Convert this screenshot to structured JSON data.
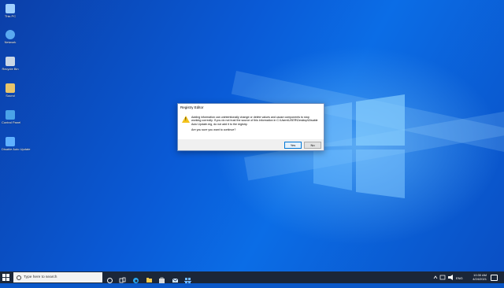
{
  "desktop": {
    "icons": [
      {
        "label": "This PC",
        "icon": "this-pc-icon",
        "color": "#9fd0ff"
      },
      {
        "label": "Network",
        "icon": "network-icon",
        "color": "#5aa9f0"
      },
      {
        "label": "Recycle Bin",
        "icon": "recycle-bin-icon",
        "color": "#c9d6e6"
      },
      {
        "label": "Sound",
        "icon": "folder-icon",
        "color": "#e8c46a"
      },
      {
        "label": "Control Panel",
        "icon": "control-panel-icon",
        "color": "#4aa3e8"
      },
      {
        "label": "Disable Auto Update",
        "icon": "registry-file-icon",
        "color": "#5fb0ff"
      }
    ]
  },
  "dialog": {
    "title": "Registry Editor",
    "message_1": "Adding information can unintentionally change or delete values and cause components to stop working correctly. If you do not trust the source of this information in C:\\Users\\USER\\Desktop\\Disable Auto Update.reg, do not add it to the registry.",
    "message_2": "Are you sure you want to continue?",
    "yes_label": "Yes",
    "no_label": "No",
    "warning_icon": "warning-icon"
  },
  "taskbar": {
    "search_placeholder": "Type here to search",
    "pinned": [
      "task-view-icon",
      "edge-icon",
      "file-explorer-icon",
      "store-icon",
      "mail-icon",
      "registry-icon"
    ],
    "time": "10:30 AM",
    "date": "4/24/2021"
  },
  "colors": {
    "taskbar_bg": "#1b2638",
    "accent": "#0078d7",
    "warning": "#f3c21b"
  }
}
